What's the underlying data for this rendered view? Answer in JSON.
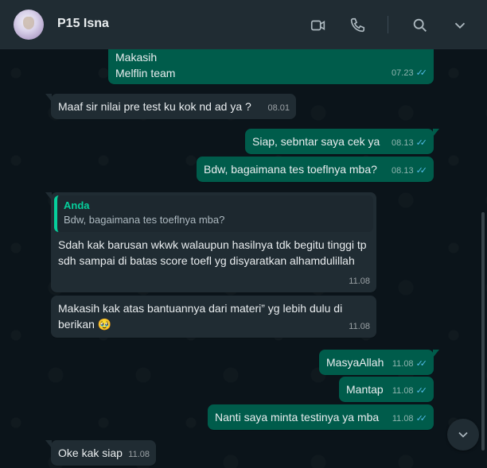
{
  "contact": {
    "name": "P15 Isna"
  },
  "header_icons": [
    "video-call-icon",
    "voice-call-icon",
    "search-icon",
    "menu-chevron-icon"
  ],
  "messages": [
    {
      "dir": "out",
      "lines": [
        "Makasih",
        "Melflin team"
      ],
      "time": "07.23",
      "read": true
    },
    {
      "dir": "in",
      "text": "Maaf sir nilai pre test ku kok nd ad ya ?",
      "time": "08.01"
    },
    {
      "dir": "out",
      "text": "Siap, sebntar saya cek ya",
      "time": "08.13",
      "read": true
    },
    {
      "dir": "out",
      "text": "Bdw, bagaimana tes toeflnya mba?",
      "time": "08.13",
      "read": true
    },
    {
      "dir": "in",
      "quote": {
        "author": "Anda",
        "text": "Bdw, bagaimana tes toeflnya mba?"
      },
      "text": "Sdah kak barusan wkwk walaupun hasilnya tdk begitu tinggi tp sdh sampai di batas score toefl yg disyaratkan alhamdulillah",
      "time": "11.08"
    },
    {
      "dir": "in",
      "text": "Makasih kak atas bantuannya dari materi” yg lebih dulu di berikan 🥹",
      "time": "11.08"
    },
    {
      "dir": "out",
      "text": "MasyaAllah",
      "time": "11.08",
      "read": true
    },
    {
      "dir": "out",
      "text": "Mantap",
      "time": "11.08",
      "read": true
    },
    {
      "dir": "out",
      "text": "Nanti saya minta testinya ya mba",
      "time": "11.08",
      "read": true
    },
    {
      "dir": "in",
      "text": "Oke kak siap",
      "time": "11.08"
    }
  ],
  "colors": {
    "incoming": "#202c33",
    "outgoing": "#005c4b",
    "read_ticks": "#53bdeb",
    "accent": "#06cf9c"
  },
  "ticks": "✓✓"
}
